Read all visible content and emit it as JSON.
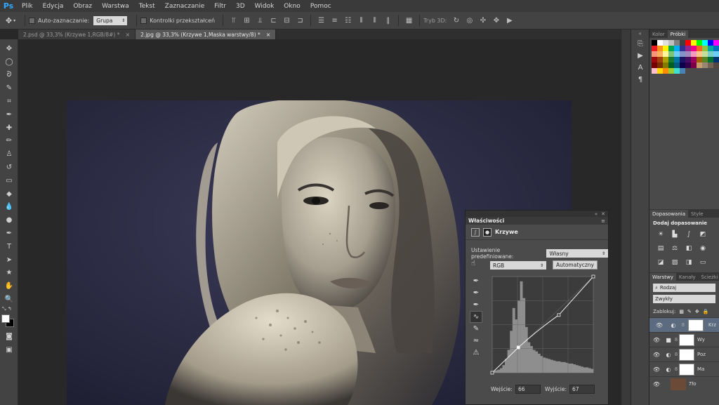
{
  "app": {
    "logo": "Ps"
  },
  "menu": [
    "Plik",
    "Edycja",
    "Obraz",
    "Warstwa",
    "Tekst",
    "Zaznaczanie",
    "Filtr",
    "3D",
    "Widok",
    "Okno",
    "Pomoc"
  ],
  "options": {
    "auto_select_label": "Auto-zaznaczanie:",
    "auto_select_value": "Grupa",
    "transform_label": "Kontrolki przekształceń",
    "mode3d_label": "Tryb 3D:"
  },
  "tabs": [
    {
      "label": "2.psd @ 33,3% (Krzywe 1,RGB/8#) *",
      "active": false
    },
    {
      "label": "2.jpg @ 33,3% (Krzywe 1,Maska warstwy/8) *",
      "active": true
    }
  ],
  "tools": [
    "move-icon",
    "marquee-icon",
    "lasso-icon",
    "quick-select-icon",
    "crop-icon",
    "eyedropper-icon",
    "healing-icon",
    "brush-icon",
    "stamp-icon",
    "history-brush-icon",
    "eraser-icon",
    "paint-bucket-icon",
    "blur-icon",
    "dodge-icon",
    "pen-icon",
    "type-icon",
    "path-select-icon",
    "shape-icon",
    "hand-icon",
    "zoom-icon"
  ],
  "tool_glyphs": [
    "✥",
    "◯",
    "ᘐ",
    "✎",
    "⌗",
    "✒",
    "✚",
    "✏",
    "♙",
    "↺",
    "▭",
    "◆",
    "💧",
    "●",
    "✒",
    "T",
    "➤",
    "★",
    "✋",
    "🔍"
  ],
  "properties": {
    "title": "Właściwości",
    "layer_type": "Krzywe",
    "preset_label": "Ustawienie predefiniowane:",
    "preset_value": "Własny",
    "channel_value": "RGB",
    "auto_button": "Automatyczny",
    "input_label": "Wejście:",
    "input_value": "66",
    "output_label": "Wyjście:",
    "output_value": "67"
  },
  "panels": {
    "color_tab": "Kolor",
    "swatches_tab": "Próbki",
    "adjustments_tab": "Dopasowania",
    "styles_tab": "Style",
    "adjustments_title": "Dodaj dopasowanie",
    "layers_tab": "Warstwy",
    "channels_tab": "Kanały",
    "paths_tab": "Ścieżki",
    "layers_filter": "Rodzaj",
    "blend_mode": "Zwykły",
    "lock_label": "Zablokuj:"
  },
  "layers": [
    {
      "name": "Krz",
      "selected": true,
      "adj": "◐"
    },
    {
      "name": "Wy",
      "selected": false,
      "adj": "■"
    },
    {
      "name": "Poz",
      "selected": false,
      "adj": "◐"
    },
    {
      "name": "Ma",
      "selected": false,
      "adj": "◐"
    },
    {
      "name": "Tło",
      "selected": false,
      "adj": ""
    }
  ],
  "swatch_colors": [
    "#000000",
    "#ffffff",
    "#e0e0e0",
    "#c0c0c0",
    "#808080",
    "#404040",
    "#ff0000",
    "#ffff00",
    "#00ff00",
    "#00ffff",
    "#0000ff",
    "#ff00ff",
    "#ed1c24",
    "#f7941d",
    "#fff200",
    "#00a651",
    "#00aeef",
    "#2e3192",
    "#92278f",
    "#ec008c",
    "#f26522",
    "#8dc63f",
    "#00a99d",
    "#0072bc",
    "#f69679",
    "#fbaf5d",
    "#fff799",
    "#7cc576",
    "#6dcff6",
    "#8393ca",
    "#a186be",
    "#f49ac1",
    "#fdc68a",
    "#c4df9b",
    "#7accc8",
    "#6ecff6",
    "#9e0b0f",
    "#a0410d",
    "#aba000",
    "#197b30",
    "#0076a3",
    "#1b1464",
    "#440e62",
    "#9e005d",
    "#a36209",
    "#598527",
    "#007236",
    "#003471",
    "#790000",
    "#7b2e00",
    "#827b00",
    "#005e20",
    "#005b7f",
    "#0d004c",
    "#32004b",
    "#7b0046",
    "#c69c6d",
    "#998675",
    "#736357",
    "#534741",
    "#ffc0cb",
    "#ffd700",
    "#ff8c00",
    "#9acd32",
    "#40e0d0",
    "#4682b4"
  ],
  "curve": {
    "points": [
      [
        0,
        0
      ],
      [
        66,
        67
      ],
      [
        168,
        153
      ],
      [
        255,
        255
      ]
    ],
    "hist": [
      2,
      3,
      4,
      6,
      10,
      18,
      30,
      55,
      85,
      70,
      95,
      120,
      98,
      60,
      40,
      35,
      30,
      28,
      25,
      22,
      20,
      19,
      18,
      17,
      16,
      15,
      15,
      14,
      14,
      13,
      12,
      12,
      11,
      10,
      9,
      8,
      7,
      7,
      6,
      5
    ]
  }
}
